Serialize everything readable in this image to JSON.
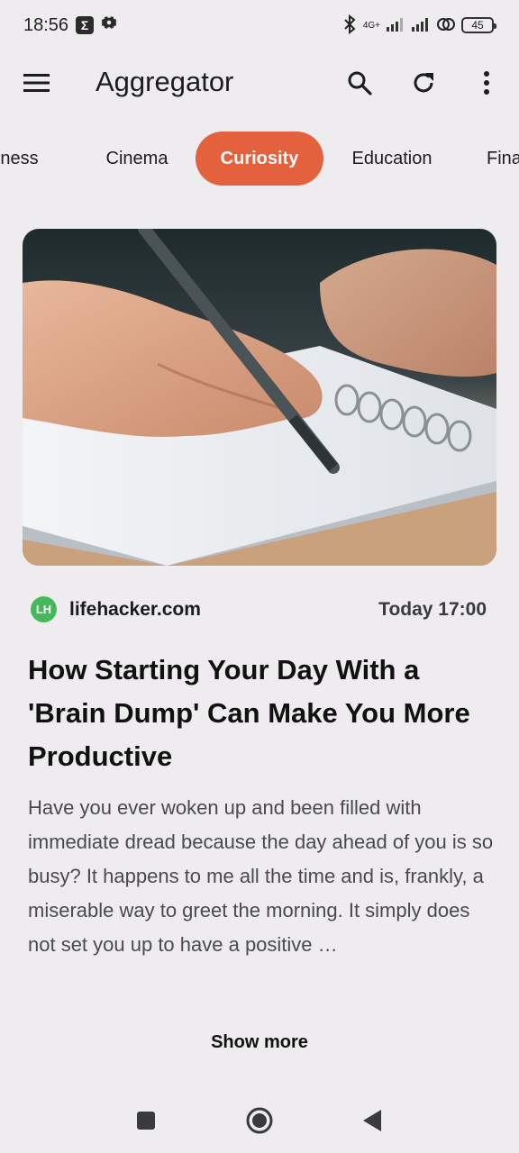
{
  "status_bar": {
    "time": "18:56",
    "network": "4G+",
    "battery": "45"
  },
  "app_bar": {
    "title": "Aggregator"
  },
  "tabs": [
    {
      "label": "Business"
    },
    {
      "label": "Cinema"
    },
    {
      "label": "Curiosity",
      "active": true
    },
    {
      "label": "Education"
    },
    {
      "label": "Finance"
    }
  ],
  "article": {
    "source": "lifehacker.com",
    "source_logo": "LH",
    "time": "Today 17:00",
    "title": "How Starting Your Day With a 'Brain Dump' Can Make You More Productive",
    "excerpt": "Have you ever woken up and been filled with immediate dread because the day ahead of you is so busy? It happens to me all the time and is, frankly, a miserable way to greet the morning. It simply does not set you up to have a positive …",
    "image_description": "hand-writing-in-notebook"
  },
  "show_more_label": "Show more",
  "colors": {
    "accent": "#e4613d",
    "background": "#eeecef",
    "source_logo": "#46b85c"
  }
}
